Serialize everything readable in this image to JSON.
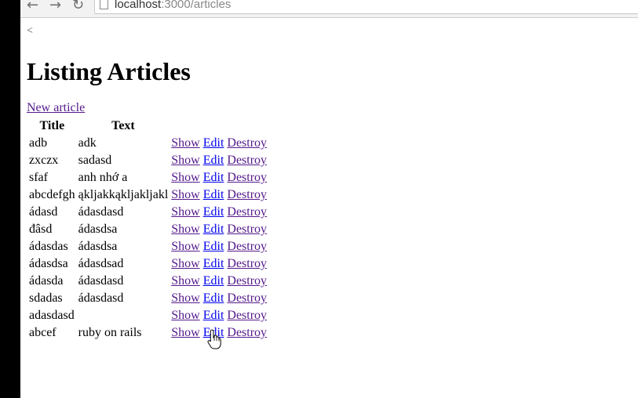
{
  "browser": {
    "url_host": "localhost",
    "url_path": ":3000/articles"
  },
  "page": {
    "back_text": "<",
    "title": "Listing Articles",
    "new_link": "New article",
    "table": {
      "headers": [
        "Title",
        "Text"
      ],
      "actions": [
        "Show",
        "Edit",
        "Destroy"
      ],
      "rows": [
        {
          "title": "adb",
          "text": "adk"
        },
        {
          "title": "zxczx",
          "text": "sadasd"
        },
        {
          "title": "sfaf",
          "text": "anh nhớ a"
        },
        {
          "title": "abcdefgh",
          "text": "ąkljakkąkljakljakl"
        },
        {
          "title": "ádasd",
          "text": "ádasdasd"
        },
        {
          "title": "đâsd",
          "text": "ádasdsa"
        },
        {
          "title": "ádasdas",
          "text": "ádasdsa"
        },
        {
          "title": "ádasdsa",
          "text": "ádasdsad"
        },
        {
          "title": "ádasda",
          "text": "ádasdasd"
        },
        {
          "title": "sdadas",
          "text": "ádasdasd"
        },
        {
          "title": "adasdasd",
          "text": ""
        },
        {
          "title": "abcef",
          "text": "ruby on rails"
        }
      ]
    }
  },
  "colors": {
    "visited_link": "#551a8b",
    "unvisited_link": "#0000ee"
  }
}
